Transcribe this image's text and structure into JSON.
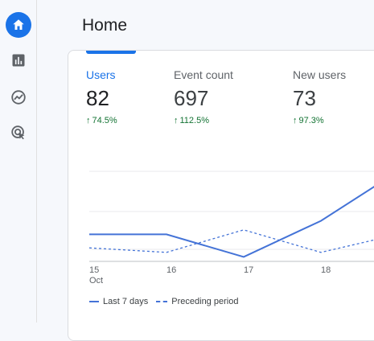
{
  "page": {
    "title": "Home"
  },
  "nav": {
    "items": [
      {
        "name": "home",
        "icon": "home-icon",
        "active": true
      },
      {
        "name": "reports",
        "icon": "bar-chart-icon",
        "active": false
      },
      {
        "name": "explore",
        "icon": "explore-icon",
        "active": false
      },
      {
        "name": "advertising",
        "icon": "advertising-icon",
        "active": false
      }
    ]
  },
  "metrics": [
    {
      "label": "Users",
      "value": "82",
      "change": "74.5%",
      "active": true
    },
    {
      "label": "Event count",
      "value": "697",
      "change": "112.5%",
      "active": false
    },
    {
      "label": "New users",
      "value": "73",
      "change": "97.3%",
      "active": false
    }
  ],
  "colors": {
    "accent": "#1a73e8",
    "line": "#4473d7",
    "positive": "#137333"
  },
  "chart_data": {
    "type": "line",
    "x": [
      "15",
      "16",
      "17",
      "18"
    ],
    "x_sublabel": "Oct",
    "series": [
      {
        "name": "Last 7 days",
        "style": "solid",
        "values": [
          6,
          6,
          1,
          9,
          20
        ]
      },
      {
        "name": "Preceding period",
        "style": "dashed",
        "values": [
          3,
          2,
          7,
          2,
          6
        ]
      }
    ],
    "ylim": [
      0,
      20
    ],
    "grid": true
  },
  "legend": {
    "current": "Last 7 days",
    "previous": "Preceding period"
  }
}
